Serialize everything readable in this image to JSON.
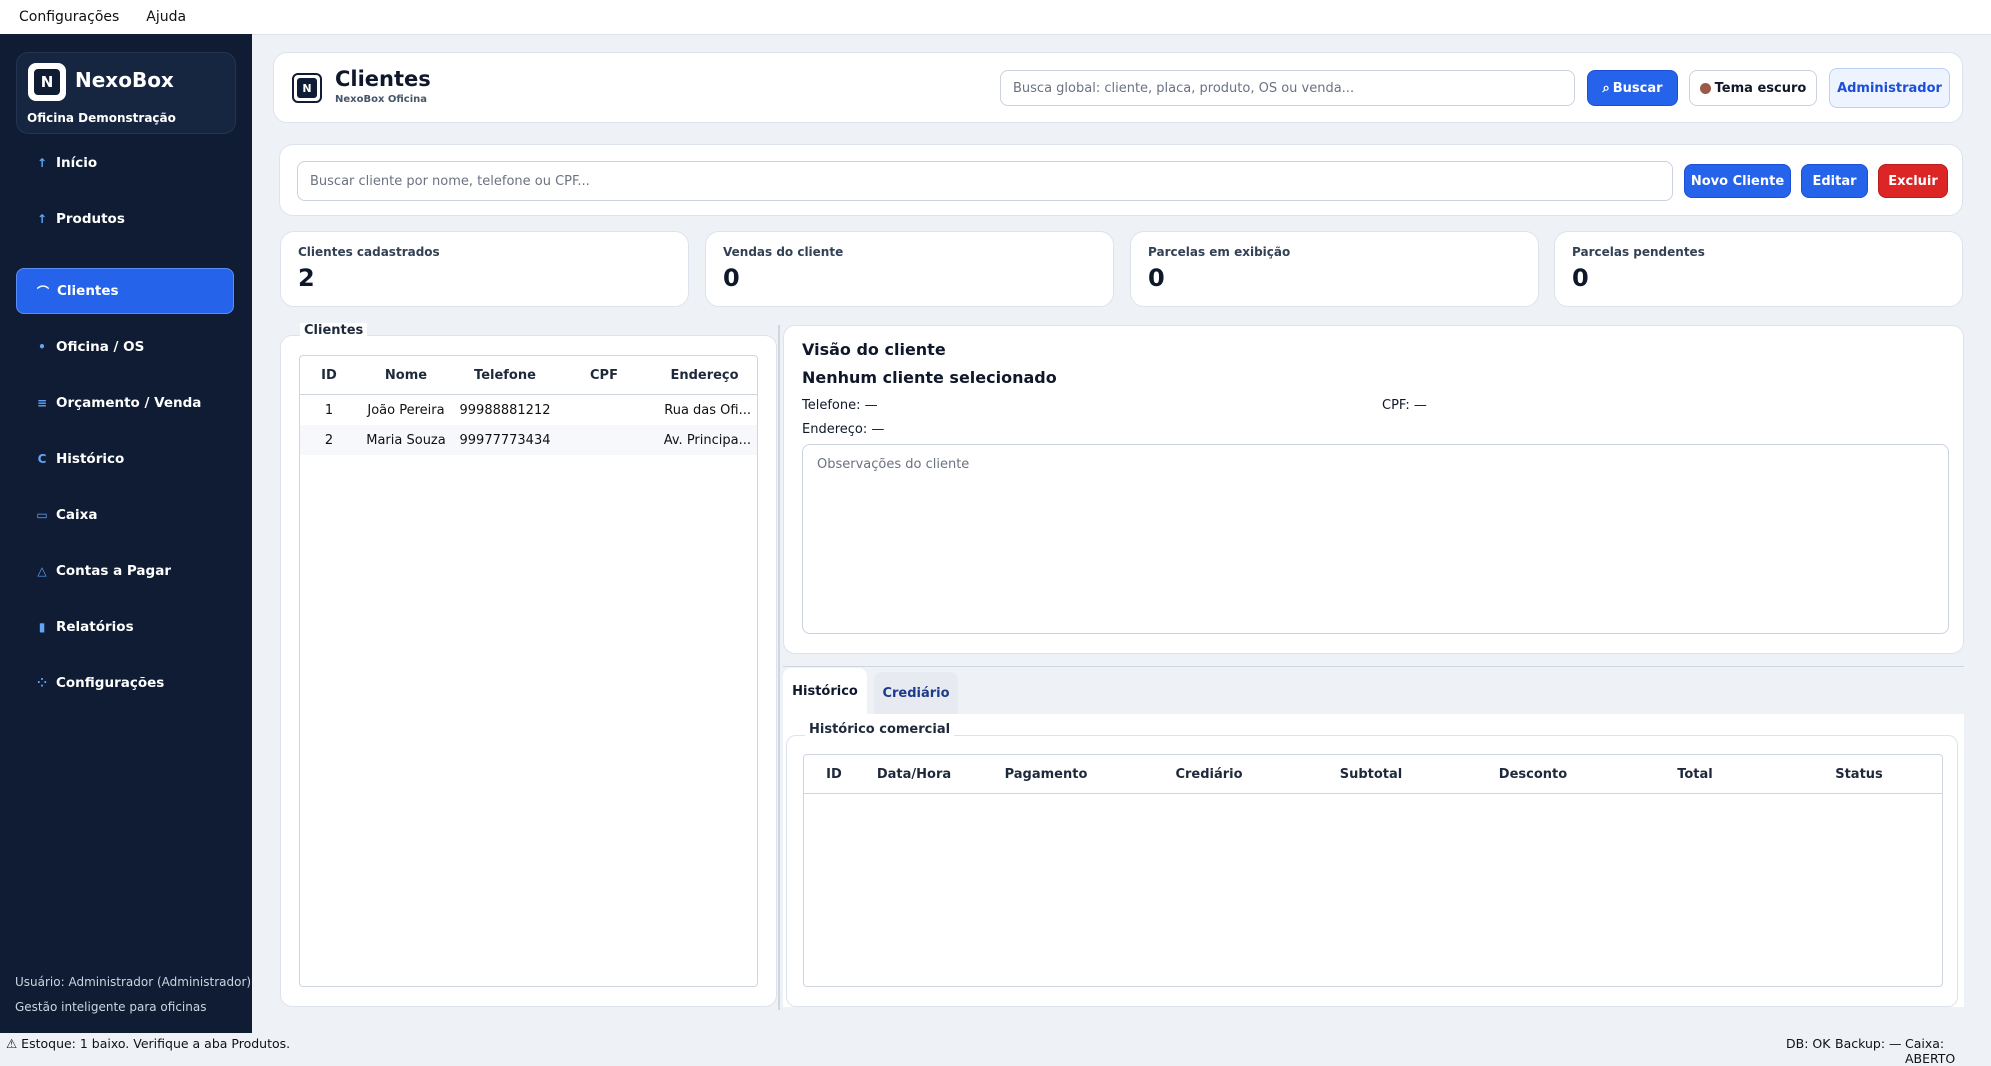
{
  "menu": [
    "Configurações",
    "Ajuda"
  ],
  "brand": {
    "name": "NexoBox",
    "sub": "Oficina Demonstração",
    "logo": "N"
  },
  "nav": [
    {
      "label": "Início",
      "icon": "↑"
    },
    {
      "label": "Produtos",
      "icon": "↑"
    },
    {
      "label": "Clientes",
      "icon": "⌒"
    },
    {
      "label": "Oficina / OS",
      "icon": "•"
    },
    {
      "label": "Orçamento / Venda",
      "icon": "≡"
    },
    {
      "label": "Histórico",
      "icon": "C"
    },
    {
      "label": "Caixa",
      "icon": "▭"
    },
    {
      "label": "Contas a Pagar",
      "icon": "△"
    },
    {
      "label": "Relatórios",
      "icon": "▮"
    },
    {
      "label": "Configurações",
      "icon": "⁘"
    }
  ],
  "sidebar_footer": {
    "user": "Usuário: Administrador (Administrador)",
    "tagline": "Gestão inteligente para oficinas"
  },
  "header": {
    "title": "Clientes",
    "subtitle": "NexoBox Oficina",
    "global_search_placeholder": "Busca global: cliente, placa, produto, OS ou venda...",
    "search_button": "Buscar",
    "theme_button": "Tema escuro",
    "admin_button": "Administrador"
  },
  "toolbar": {
    "search_placeholder": "Buscar cliente por nome, telefone ou CPF...",
    "new_button": "Novo Cliente",
    "edit_button": "Editar",
    "delete_button": "Excluir"
  },
  "stats": [
    {
      "label": "Clientes cadastrados",
      "value": "2"
    },
    {
      "label": "Vendas do cliente",
      "value": "0"
    },
    {
      "label": "Parcelas em exibição",
      "value": "0"
    },
    {
      "label": "Parcelas pendentes",
      "value": "0"
    }
  ],
  "clients": {
    "label": "Clientes",
    "columns": [
      "ID",
      "Nome",
      "Telefone",
      "CPF",
      "Endereço"
    ],
    "rows": [
      [
        "1",
        "João Pereira",
        "99988881212",
        "",
        "Rua das Ofi..."
      ],
      [
        "2",
        "Maria Souza",
        "99977773434",
        "",
        "Av. Principa..."
      ]
    ]
  },
  "detail": {
    "heading": "Visão do cliente",
    "selected": "Nenhum cliente selecionado",
    "phone": "Telefone: —",
    "cpf": "CPF: —",
    "address": "Endereço: —",
    "notes_placeholder": "Observações do cliente"
  },
  "tabs": [
    "Histórico",
    "Crediário"
  ],
  "history": {
    "label": "Histórico comercial",
    "columns": [
      "ID",
      "Data/Hora",
      "Pagamento",
      "Crediário",
      "Subtotal",
      "Desconto",
      "Total",
      "Status"
    ]
  },
  "status_bar": {
    "left": "⚠ Estoque: 1 baixo. Verifique a aba Produtos.",
    "db": "DB: OK",
    "backup": "Backup: —",
    "caixa": "Caixa: ABERTO"
  },
  "colors": {
    "sidebar": "#0f1c33",
    "accent": "#2563eb",
    "danger": "#dc2626"
  }
}
